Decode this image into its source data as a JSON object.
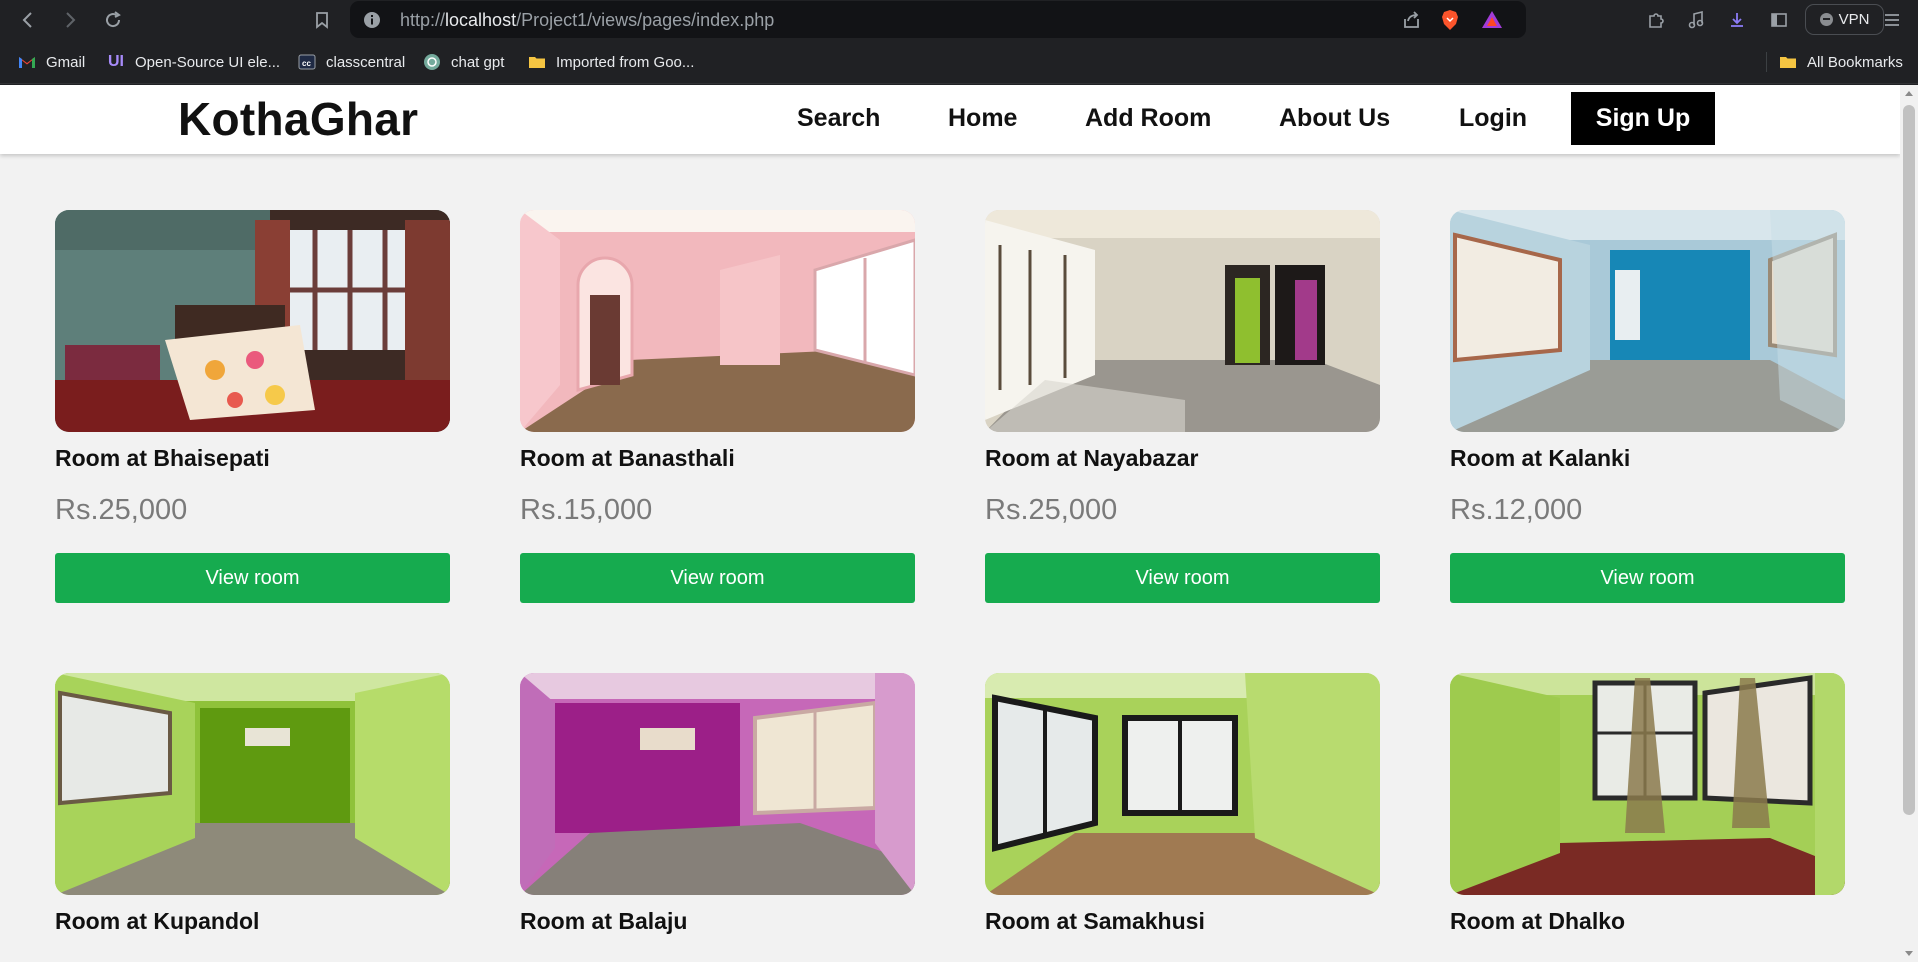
{
  "browser": {
    "url_prefix": "http://",
    "url_host": "localhost",
    "url_path": "/Project1/views/pages/index.php",
    "vpn_label": "VPN",
    "bookmarks": [
      {
        "label": "Gmail",
        "icon": "gmail-icon"
      },
      {
        "label": "Open-Source UI ele...",
        "icon": "ui-icon"
      },
      {
        "label": "classcentral",
        "icon": "classcentral-icon"
      },
      {
        "label": "chat gpt",
        "icon": "chatgpt-icon"
      },
      {
        "label": "Imported from Goo...",
        "icon": "folder-icon"
      }
    ],
    "all_bookmarks_label": "All Bookmarks"
  },
  "site": {
    "brand": "KothaGhar",
    "nav": {
      "search": "Search",
      "home": "Home",
      "add_room": "Add Room",
      "about": "About Us",
      "login": "Login",
      "signup": "Sign Up"
    },
    "button_color": "#16ab4f"
  },
  "rooms": [
    {
      "title": "Room at Bhaisepati",
      "price": "Rs.25,000",
      "button": "View room"
    },
    {
      "title": "Room at Banasthali",
      "price": "Rs.15,000",
      "button": "View room"
    },
    {
      "title": "Room at Nayabazar",
      "price": "Rs.25,000",
      "button": "View room"
    },
    {
      "title": "Room at Kalanki",
      "price": "Rs.12,000",
      "button": "View room"
    },
    {
      "title": "Room at Kupandol",
      "price": "",
      "button": ""
    },
    {
      "title": "Room at Balaju",
      "price": "",
      "button": ""
    },
    {
      "title": "Room at Samakhusi",
      "price": "",
      "button": ""
    },
    {
      "title": "Room at Dhalko",
      "price": "",
      "button": ""
    }
  ]
}
